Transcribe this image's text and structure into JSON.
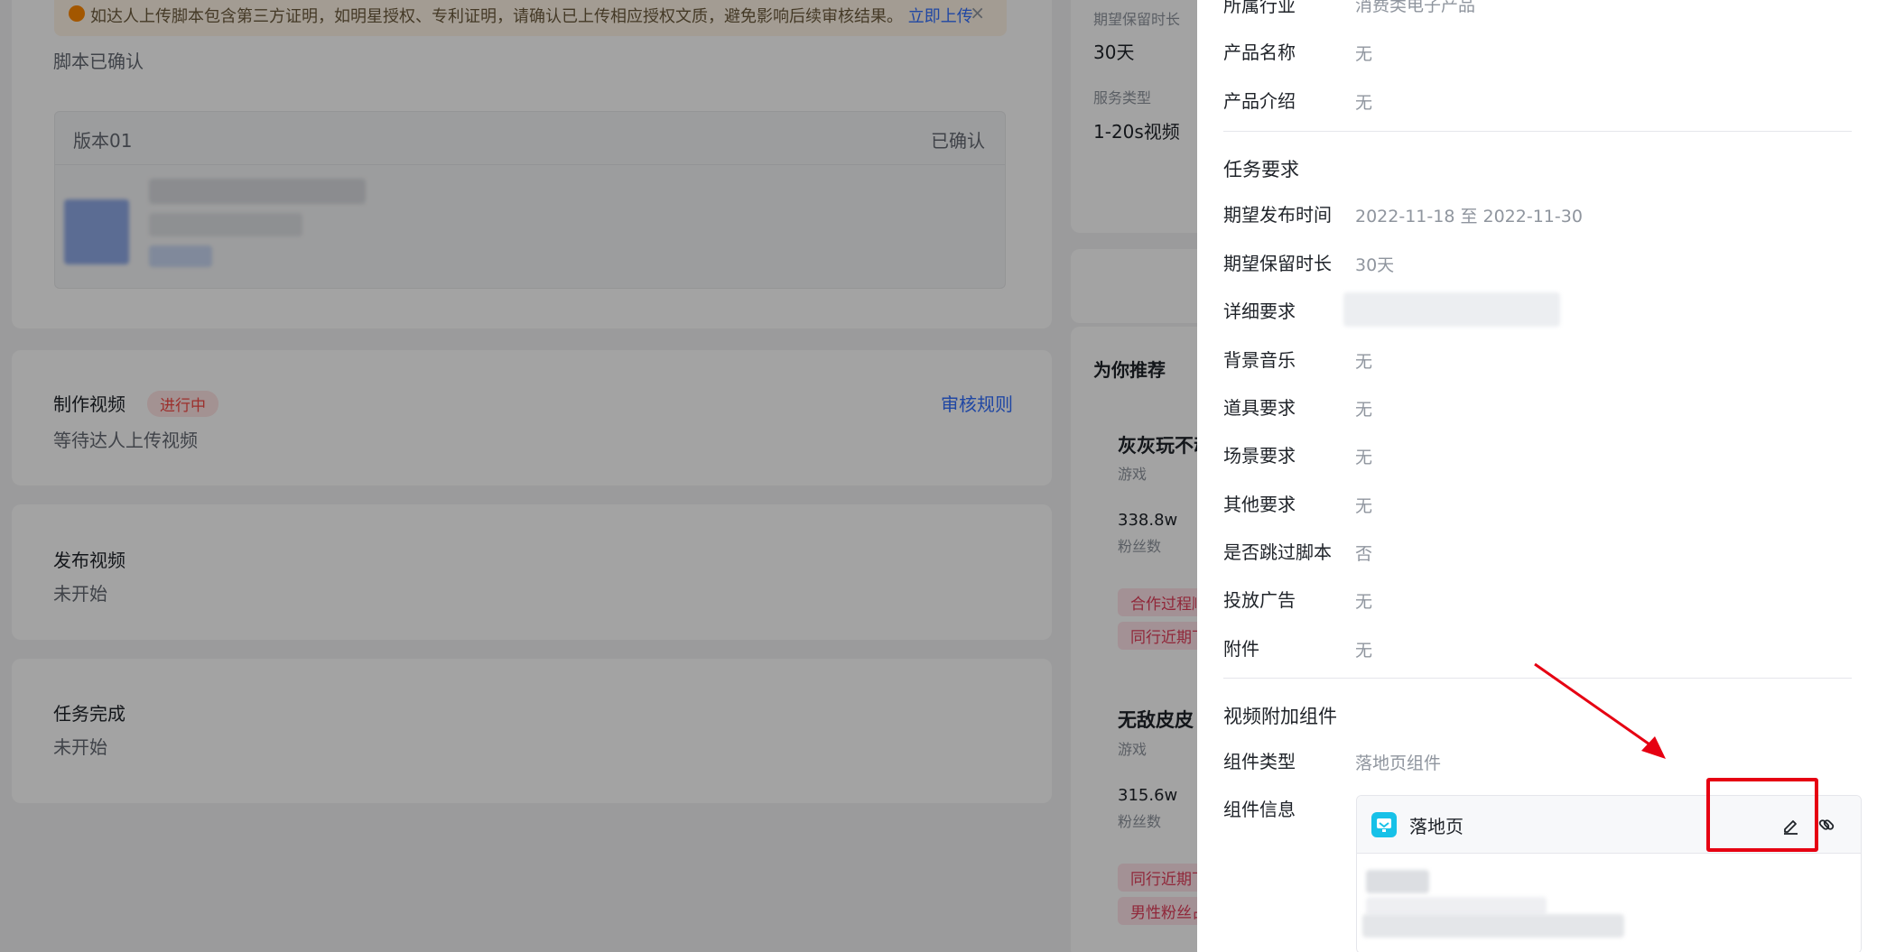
{
  "background": {
    "notice": {
      "text": "如达人上传脚本包含第三方证明，如明星授权、专利证明，请确认已上传相应授权文质，避免影响后续审核结果。",
      "link": "立即上传",
      "close": "×"
    },
    "script_status": "脚本已确认",
    "version": {
      "name": "版本01",
      "status": "已确认"
    },
    "steps": [
      {
        "title": "制作视频",
        "badge": "进行中",
        "desc": "等待达人上传视频",
        "rule_link": "审核规则"
      },
      {
        "title": "发布视频",
        "desc": "未开始"
      },
      {
        "title": "任务完成",
        "desc": "未开始"
      }
    ],
    "side": {
      "retention_label": "期望保留时长",
      "retention_value": "30天",
      "service_label": "服务类型",
      "service_value": "1-20s视频",
      "recommend_title": "为你推荐",
      "recommendations": [
        {
          "name": "灰灰玩不动",
          "category": "游戏",
          "fans": "338.8w",
          "fans_label": "粉丝数",
          "tags": [
            "合作过程顺利",
            "同行近期下单"
          ]
        },
        {
          "name": "无敌皮皮",
          "category": "游戏",
          "fans": "315.6w",
          "fans_label": "粉丝数",
          "tags": [
            "同行近期下单",
            "男性粉丝占比高"
          ]
        }
      ]
    }
  },
  "drawer": {
    "product_fields": [
      {
        "label": "所属行业",
        "value": "消费类电子产品"
      },
      {
        "label": "产品名称",
        "value": "无"
      },
      {
        "label": "产品介绍",
        "value": "无"
      }
    ],
    "task_section_title": "任务要求",
    "task_fields": [
      {
        "label": "期望发布时间",
        "value": "2022-11-18 至 2022-11-30"
      },
      {
        "label": "期望保留时长",
        "value": "30天"
      },
      {
        "label": "详细要求",
        "value": ""
      },
      {
        "label": "背景音乐",
        "value": "无"
      },
      {
        "label": "道具要求",
        "value": "无"
      },
      {
        "label": "场景要求",
        "value": "无"
      },
      {
        "label": "其他要求",
        "value": "无"
      },
      {
        "label": "是否跳过脚本",
        "value": "否"
      },
      {
        "label": "投放广告",
        "value": "无"
      },
      {
        "label": "附件",
        "value": "无"
      }
    ],
    "component_section_title": "视频附加组件",
    "component_type_label": "组件类型",
    "component_type_value": "落地页组件",
    "component_info_label": "组件信息",
    "component_card": {
      "name": "落地页"
    }
  },
  "colors": {
    "accent_blue": "#3370ff",
    "status_red": "#f54a45",
    "annotation_red": "#e60012",
    "landing_logo": "#17c1e8"
  }
}
